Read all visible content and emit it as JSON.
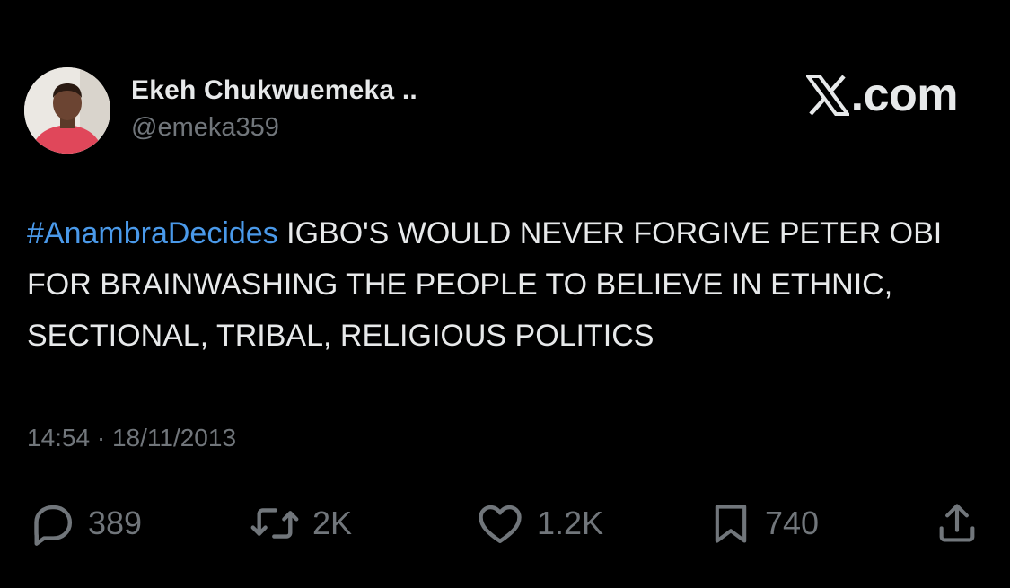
{
  "author": {
    "display_name": "Ekeh Chukwuemeka ..",
    "handle": "@emeka359",
    "avatar_icon": "user-photo-avatar"
  },
  "brand": {
    "label": ".com",
    "icon": "x-logo-icon"
  },
  "tweet": {
    "hashtag": "#AnambraDecides",
    "body": " IGBO'S WOULD NEVER FORGIVE PETER OBI FOR BRAINWASHING THE PEOPLE TO BELIEVE IN ETHNIC, SECTIONAL, TRIBAL, RELIGIOUS POLITICS",
    "timestamp": "14:54 · 18/11/2013"
  },
  "metrics": {
    "replies": "389",
    "reposts": "2K",
    "likes": "1.2K",
    "bookmarks": "740"
  },
  "colors": {
    "background": "#000000",
    "text_primary": "#e7e9ea",
    "text_secondary": "#71767b",
    "hashtag": "#4a99e9"
  }
}
